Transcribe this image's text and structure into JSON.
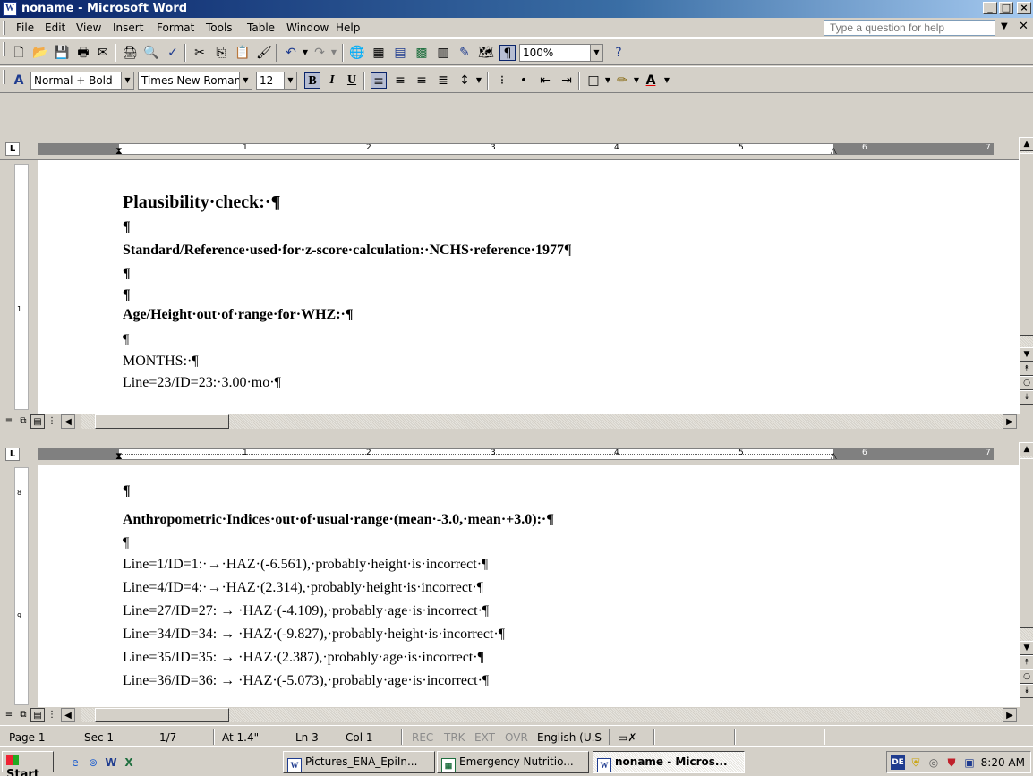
{
  "window": {
    "title": "noname - Microsoft Word",
    "caption_buttons": [
      "_",
      "□",
      "×"
    ]
  },
  "menubar": {
    "items": [
      "File",
      "Edit",
      "View",
      "Insert",
      "Format",
      "Tools",
      "Table",
      "Window",
      "Help"
    ],
    "help_placeholder": "Type a question for help"
  },
  "standard_toolbar": {
    "zoom": "100%"
  },
  "formatting_toolbar": {
    "style": "Normal + Bold",
    "font": "Times New Roman",
    "size": "12",
    "bold": "B",
    "italic": "I",
    "underline": "U"
  },
  "ruler": {
    "numbers": [
      "1",
      "2",
      "3",
      "4",
      "5",
      "6",
      "7"
    ]
  },
  "top_pane": {
    "vruler_mark": "1",
    "lines": [
      "Plausibility·check:·¶",
      "¶",
      "Standard/Reference·used·for·z-score·calculation:·NCHS·reference·1977¶",
      "¶",
      "¶",
      "Age/Height·out·of·range·for·WHZ:·¶",
      "¶",
      "MONTHS:·¶",
      "Line=23/ID=23:·3.00·mo·¶"
    ]
  },
  "bottom_pane": {
    "vruler_marks": [
      "8",
      "9"
    ],
    "lines": [
      "¶",
      "Anthropometric·Indices·out·of·usual·range·(mean·-3.0,·mean·+3.0):·¶",
      "¶",
      "Line=1/ID=1:·→·HAZ·(-6.561),·probably·height·is·incorrect·¶",
      "Line=4/ID=4:·→·HAZ·(2.314),·probably·height·is·incorrect·¶",
      "Line=27/ID=27:  →   ·HAZ·(-4.109),·probably·age·is·incorrect·¶",
      "Line=34/ID=34:  →   ·HAZ·(-9.827),·probably·height·is·incorrect·¶",
      "Line=35/ID=35:  →   ·HAZ·(2.387),·probably·age·is·incorrect·¶",
      "Line=36/ID=36:  →   ·HAZ·(-5.073),·probably·age·is·incorrect·¶"
    ]
  },
  "statusbar": {
    "page": "Page 1",
    "sec": "Sec 1",
    "of": "1/7",
    "at": "At 1.4\"",
    "ln": "Ln 3",
    "col": "Col 1",
    "modes": [
      "REC",
      "TRK",
      "EXT",
      "OVR"
    ],
    "language": "English (U.S"
  },
  "taskbar": {
    "start": "Start",
    "tasks": [
      "Pictures_ENA_EpiIn...",
      "Emergency Nutritio...",
      "noname - Micros..."
    ],
    "lang": "DE",
    "clock": "8:20 AM"
  }
}
